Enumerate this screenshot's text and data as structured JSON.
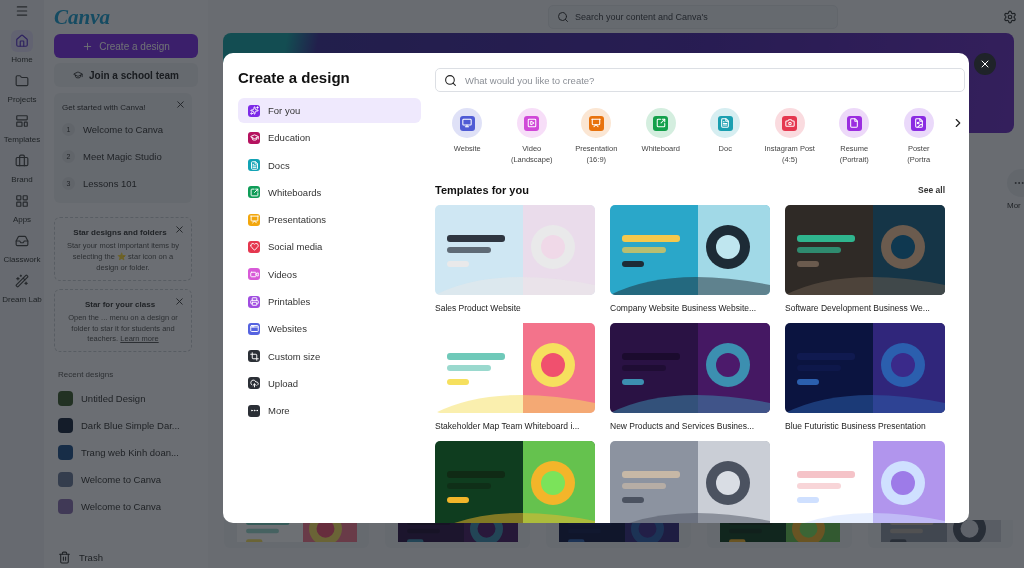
{
  "app_rail": [
    {
      "label": "Home",
      "selected": true
    },
    {
      "label": "Projects",
      "selected": false
    },
    {
      "label": "Templates",
      "selected": false
    },
    {
      "label": "Brand",
      "selected": false
    },
    {
      "label": "Apps",
      "selected": false
    },
    {
      "label": "Classwork",
      "selected": false
    },
    {
      "label": "Dream Lab",
      "selected": false
    }
  ],
  "sidebar": {
    "logo": "Canva",
    "create_button": "Create a design",
    "school_button": "Join a school team",
    "get_started": {
      "title": "Get started with Canva!",
      "steps": [
        {
          "number": "1",
          "label": "Welcome to Canva"
        },
        {
          "number": "2",
          "label": "Meet Magic Studio"
        },
        {
          "number": "3",
          "label": "Lessons 101"
        }
      ]
    },
    "tips": [
      {
        "title": "Star designs and folders",
        "text": "Star your most important items by selecting the ⭐ star icon on a design or folder."
      },
      {
        "title": "Star for your class",
        "text": "Open the ... menu on a design or folder to star it for students and teachers.",
        "link": "Learn more"
      }
    ],
    "recent_title": "Recent designs",
    "recent": [
      {
        "label": "Untitled Design"
      },
      {
        "label": "Dark Blue Simple Dar..."
      },
      {
        "label": "Trang web Kinh doan..."
      },
      {
        "label": "Welcome to Canva"
      },
      {
        "label": "Welcome to Canva"
      }
    ],
    "trash": "Trash"
  },
  "top_bar": {
    "search_placeholder": "Search your content and Canva's"
  },
  "shortcut_peek": "Mor",
  "dialog": {
    "title": "Create a design",
    "nav": [
      {
        "label": "For you",
        "selected": true,
        "color": "#7d2ae8"
      },
      {
        "label": "Education",
        "selected": false,
        "color": "#b5125f"
      },
      {
        "label": "Docs",
        "selected": false,
        "color": "#13a3b5"
      },
      {
        "label": "Whiteboards",
        "selected": false,
        "color": "#0f9d58"
      },
      {
        "label": "Presentations",
        "selected": false,
        "color": "#f2a60c"
      },
      {
        "label": "Social media",
        "selected": false,
        "color": "#e5374f"
      },
      {
        "label": "Videos",
        "selected": false,
        "color": "#d85ad8"
      },
      {
        "label": "Printables",
        "selected": false,
        "color": "#a04de0"
      },
      {
        "label": "Websites",
        "selected": false,
        "color": "#5563e0"
      },
      {
        "label": "Custom size",
        "selected": false,
        "color": "#2b2f36"
      },
      {
        "label": "Upload",
        "selected": false,
        "color": "#2b2f36"
      },
      {
        "label": "More",
        "selected": false,
        "color": "#2b2f36"
      }
    ],
    "search_placeholder": "What would you like to create?",
    "types": [
      {
        "label": "Website",
        "color": "#4f5bd5"
      },
      {
        "label": "Video (Landscape)",
        "color": "#d048d8"
      },
      {
        "label": "Presentation (16:9)",
        "color": "#e8720c"
      },
      {
        "label": "Whiteboard",
        "color": "#13a04b"
      },
      {
        "label": "Doc",
        "color": "#1a9fb0"
      },
      {
        "label": "Instagram Post (4:5)",
        "color": "#e5374f"
      },
      {
        "label": "Resume (Portrait)",
        "color": "#9b2de0"
      },
      {
        "label": "Poster (Portra",
        "color": "#8a2be2"
      }
    ],
    "templates_title": "Templates for you",
    "see_all": "See all",
    "templates": [
      {
        "kind": "picture",
        "title": "Sales Product Website"
      },
      {
        "kind": "picture",
        "title": "Company Website Business Website..."
      },
      {
        "kind": "picture",
        "title": "Software Development Business We..."
      },
      {
        "kind": "picture",
        "title": "Stakeholder Map Team Whiteboard i..."
      },
      {
        "kind": "picture",
        "title": "New Products and Services Busines..."
      },
      {
        "kind": "picture",
        "title": "Blue Futuristic Business Presentation"
      },
      {
        "kind": "picture"
      },
      {
        "kind": "picture"
      },
      {
        "kind": "picture"
      }
    ]
  },
  "recent_thumbnails": [
    {
      "kind": "picture"
    },
    {
      "kind": "picture"
    },
    {
      "kind": "picture"
    },
    {
      "kind": "picture"
    },
    {
      "kind": "picture"
    }
  ]
}
